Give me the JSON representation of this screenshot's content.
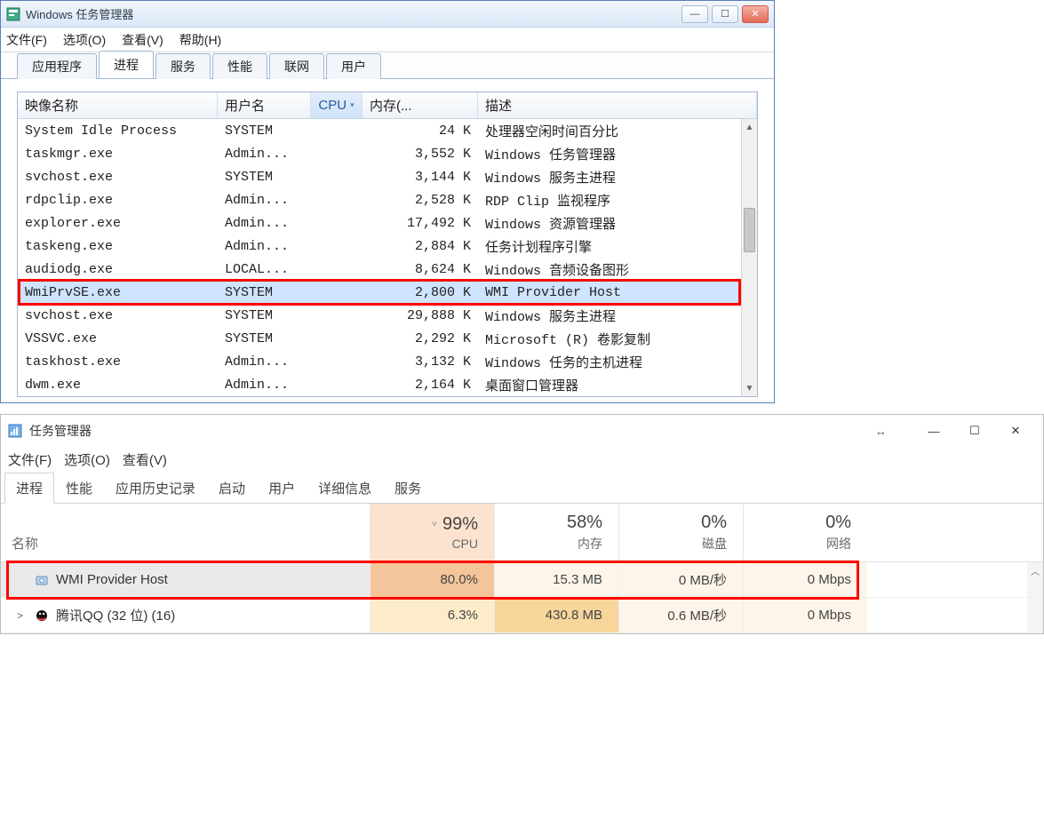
{
  "win7": {
    "title": "Windows 任务管理器",
    "menu": {
      "file": "文件(F)",
      "options": "选项(O)",
      "view": "查看(V)",
      "help": "帮助(H)"
    },
    "tabs": [
      "应用程序",
      "进程",
      "服务",
      "性能",
      "联网",
      "用户"
    ],
    "active_tab": "进程",
    "columns": {
      "image": "映像名称",
      "user": "用户名",
      "cpu": "CPU",
      "memory": "内存(...",
      "desc": "描述"
    },
    "sort_column": "cpu",
    "rows": [
      {
        "image": "System Idle Process",
        "user": "SYSTEM",
        "cpu": "",
        "memory": "24 K",
        "desc": "处理器空闲时间百分比"
      },
      {
        "image": "taskmgr.exe",
        "user": "Admin...",
        "cpu": "",
        "memory": "3,552 K",
        "desc": "Windows 任务管理器"
      },
      {
        "image": "svchost.exe",
        "user": "SYSTEM",
        "cpu": "",
        "memory": "3,144 K",
        "desc": "Windows 服务主进程"
      },
      {
        "image": "rdpclip.exe",
        "user": "Admin...",
        "cpu": "",
        "memory": "2,528 K",
        "desc": "RDP Clip 监视程序"
      },
      {
        "image": "explorer.exe",
        "user": "Admin...",
        "cpu": "",
        "memory": "17,492 K",
        "desc": "Windows 资源管理器"
      },
      {
        "image": "taskeng.exe",
        "user": "Admin...",
        "cpu": "",
        "memory": "2,884 K",
        "desc": "任务计划程序引擎"
      },
      {
        "image": "audiodg.exe",
        "user": "LOCAL...",
        "cpu": "",
        "memory": "8,624 K",
        "desc": "Windows 音频设备图形"
      },
      {
        "image": "WmiPrvSE.exe",
        "user": "SYSTEM",
        "cpu": "",
        "memory": "2,800 K",
        "desc": "WMI Provider Host",
        "selected": true,
        "highlighted": true
      },
      {
        "image": "svchost.exe",
        "user": "SYSTEM",
        "cpu": "",
        "memory": "29,888 K",
        "desc": "Windows 服务主进程"
      },
      {
        "image": "VSSVC.exe",
        "user": "SYSTEM",
        "cpu": "",
        "memory": "2,292 K",
        "desc": "Microsoft (R) 卷影复制"
      },
      {
        "image": "taskhost.exe",
        "user": "Admin...",
        "cpu": "",
        "memory": "3,132 K",
        "desc": "Windows 任务的主机进程"
      },
      {
        "image": "dwm.exe",
        "user": "Admin...",
        "cpu": "",
        "memory": "2,164 K",
        "desc": "桌面窗口管理器"
      }
    ]
  },
  "win10": {
    "title": "任务管理器",
    "menu": {
      "file": "文件(F)",
      "options": "选项(O)",
      "view": "查看(V)"
    },
    "tabs": [
      "进程",
      "性能",
      "应用历史记录",
      "启动",
      "用户",
      "详细信息",
      "服务"
    ],
    "active_tab": "进程",
    "header": {
      "name": "名称",
      "cpu": {
        "pct": "99%",
        "label": "CPU",
        "sorted": true
      },
      "mem": {
        "pct": "58%",
        "label": "内存"
      },
      "disk": {
        "pct": "0%",
        "label": "磁盘"
      },
      "net": {
        "pct": "0%",
        "label": "网络"
      }
    },
    "rows": [
      {
        "name": "WMI Provider Host",
        "expander": "",
        "cpu": "80.0%",
        "mem": "15.3 MB",
        "disk": "0 MB/秒",
        "net": "0 Mbps",
        "highlighted": true,
        "icon": "service-icon"
      },
      {
        "name": "腾讯QQ (32 位) (16)",
        "expander": ">",
        "cpu": "6.3%",
        "mem": "430.8 MB",
        "disk": "0.6 MB/秒",
        "net": "0 Mbps",
        "icon": "qq-icon"
      }
    ]
  }
}
